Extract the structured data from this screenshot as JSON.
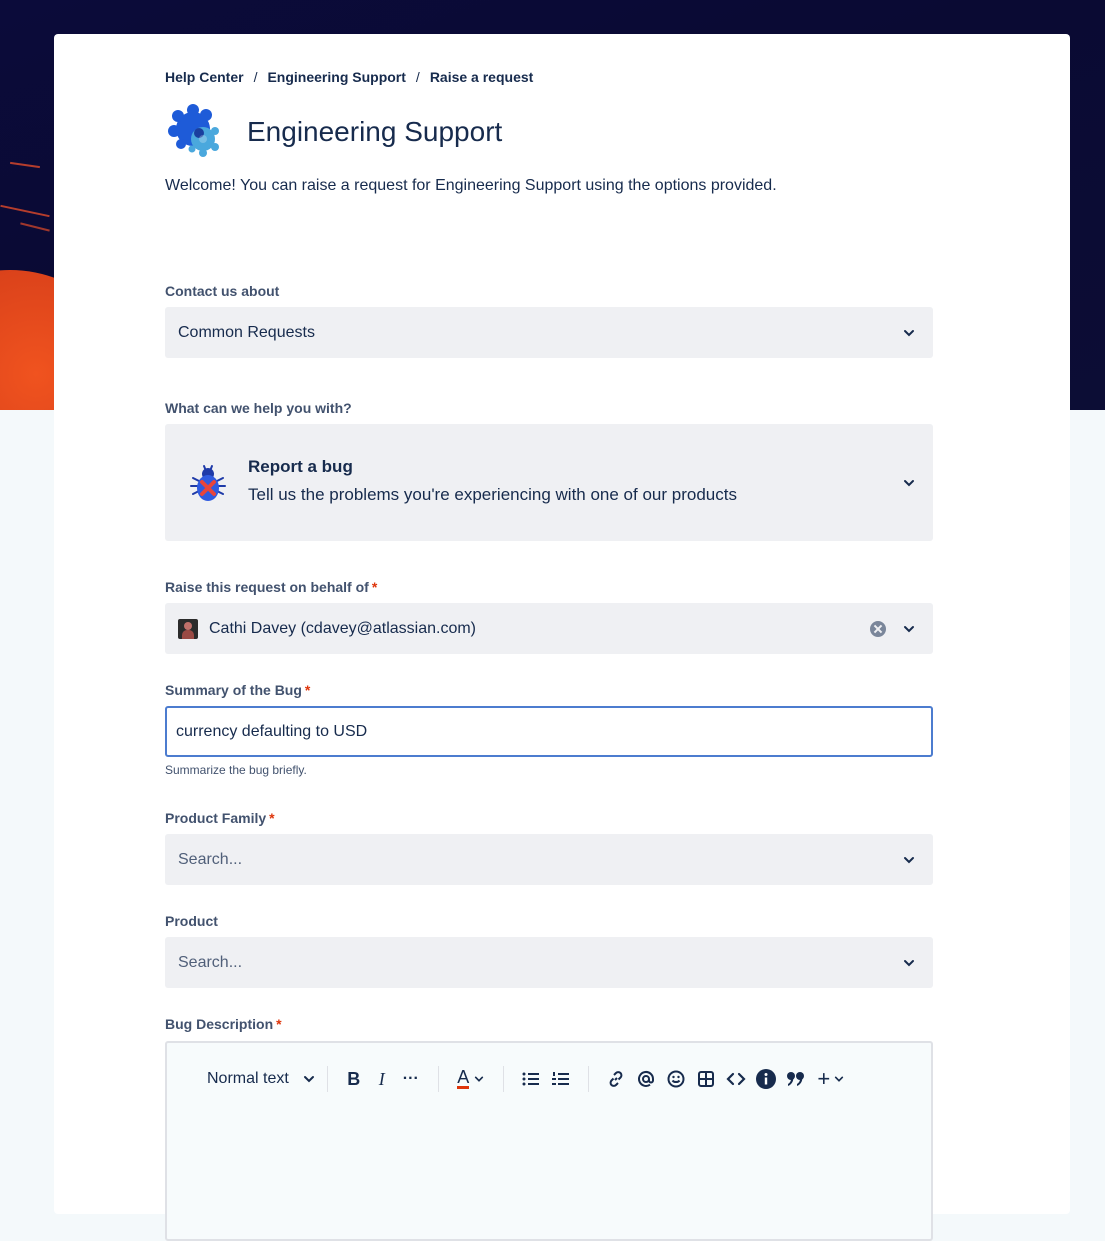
{
  "breadcrumb": {
    "items": [
      "Help Center",
      "Engineering Support",
      "Raise a request"
    ],
    "separator": "/"
  },
  "header": {
    "title": "Engineering Support",
    "logo_icon": "gear-logo-icon"
  },
  "welcome": "Welcome! You can raise a request for Engineering Support using the options provided.",
  "contact": {
    "label": "Contact us about",
    "value": "Common Requests"
  },
  "help": {
    "label": "What can we help you with?",
    "title": "Report a bug",
    "description": "Tell us the problems you're experiencing with one of our products",
    "icon": "bug-icon"
  },
  "behalf": {
    "label": "Raise this request on behalf of",
    "required": "*",
    "value": "Cathi Davey (cdavey@atlassian.com)"
  },
  "summary": {
    "label": "Summary of the Bug",
    "required": "*",
    "value": "currency defaulting to USD",
    "hint": "Summarize the bug briefly."
  },
  "product_family": {
    "label": "Product Family",
    "required": "*",
    "placeholder": "Search..."
  },
  "product": {
    "label": "Product",
    "placeholder": "Search..."
  },
  "description": {
    "label": "Bug Description",
    "required": "*",
    "toolbar": {
      "text_style": "Normal text",
      "bold": "B",
      "italic": "I",
      "more": "···",
      "color_letter": "A",
      "plus": "+"
    }
  },
  "colors": {
    "hero_bg": "#0b0b3a",
    "accent_orange": "#f0531f",
    "required": "#de350b",
    "focus_border": "#4c7ccf"
  }
}
